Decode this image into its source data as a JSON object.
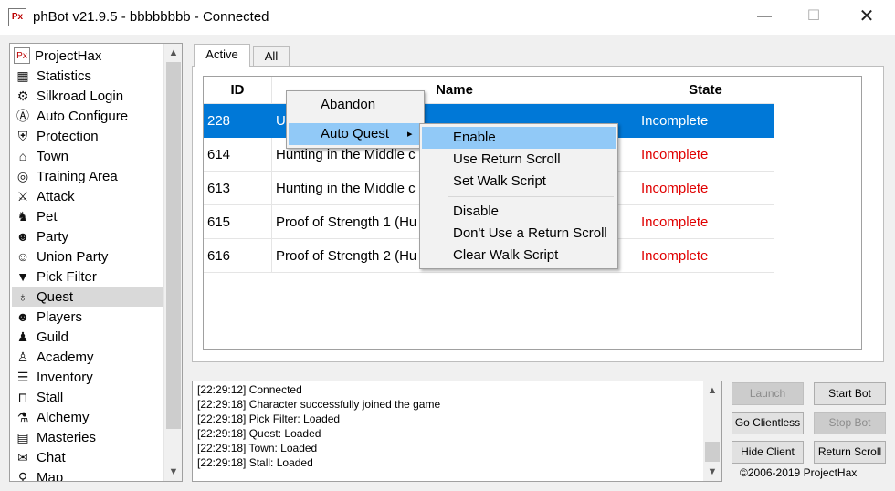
{
  "window": {
    "icon_text": "Px",
    "title": "phBot v21.9.5 - bbbbbbbb - Connected",
    "minimize": "—",
    "maximize": "☐",
    "close": "✕"
  },
  "sidebar": {
    "items": [
      {
        "label": "ProjectHax",
        "icon": "projecthax-icon",
        "glyph": "Px"
      },
      {
        "label": "Statistics",
        "icon": "statistics-icon",
        "glyph": "▦"
      },
      {
        "label": "Silkroad Login",
        "icon": "gears-icon",
        "glyph": "⚙"
      },
      {
        "label": "Auto Configure",
        "icon": "auto-configure-icon",
        "glyph": "Ⓐ"
      },
      {
        "label": "Protection",
        "icon": "shield-icon",
        "glyph": "⛨"
      },
      {
        "label": "Town",
        "icon": "town-icon",
        "glyph": "⌂"
      },
      {
        "label": "Training Area",
        "icon": "target-icon",
        "glyph": "◎"
      },
      {
        "label": "Attack",
        "icon": "sword-icon",
        "glyph": "⚔"
      },
      {
        "label": "Pet",
        "icon": "pet-icon",
        "glyph": "♞"
      },
      {
        "label": "Party",
        "icon": "party-icon",
        "glyph": "☻"
      },
      {
        "label": "Union Party",
        "icon": "union-party-icon",
        "glyph": "☺"
      },
      {
        "label": "Pick Filter",
        "icon": "filter-icon",
        "glyph": "▼"
      },
      {
        "label": "Quest",
        "icon": "quest-balloon-icon",
        "glyph": "♁",
        "selected": true
      },
      {
        "label": "Players",
        "icon": "players-icon",
        "glyph": "☻"
      },
      {
        "label": "Guild",
        "icon": "guild-icon",
        "glyph": "♟"
      },
      {
        "label": "Academy",
        "icon": "academy-icon",
        "glyph": "♙"
      },
      {
        "label": "Inventory",
        "icon": "inventory-icon",
        "glyph": "☰"
      },
      {
        "label": "Stall",
        "icon": "stall-icon",
        "glyph": "⊓"
      },
      {
        "label": "Alchemy",
        "icon": "alchemy-icon",
        "glyph": "⚗"
      },
      {
        "label": "Masteries",
        "icon": "masteries-icon",
        "glyph": "▤"
      },
      {
        "label": "Chat",
        "icon": "chat-icon",
        "glyph": "✉"
      },
      {
        "label": "Map",
        "icon": "map-icon",
        "glyph": "⚲"
      }
    ],
    "scroll_up": "▲",
    "scroll_down": "▼"
  },
  "tabs": [
    {
      "label": "Active"
    },
    {
      "label": "All"
    }
  ],
  "quest_table": {
    "headers": {
      "id": "ID",
      "name": "Name",
      "state": "State"
    },
    "rows": [
      {
        "id": "228",
        "name": "U",
        "state": "Incomplete"
      },
      {
        "id": "614",
        "name": "Hunting in the Middle c",
        "state": "Incomplete"
      },
      {
        "id": "613",
        "name": "Hunting in the Middle c",
        "state": "Incomplete"
      },
      {
        "id": "615",
        "name": "Proof of Strength 1 (Hu",
        "state": "Incomplete"
      },
      {
        "id": "616",
        "name": "Proof of Strength 2 (Hu",
        "state": "Incomplete"
      }
    ]
  },
  "context_menu": {
    "abandon": "Abandon",
    "auto_quest": "Auto Quest",
    "submenu_arrow": "▸",
    "submenu": {
      "enable": "Enable",
      "use_return_scroll": "Use Return Scroll",
      "set_walk_script": "Set Walk Script",
      "disable": "Disable",
      "dont_use_return_scroll": "Don't Use a Return Scroll",
      "clear_walk_script": "Clear Walk Script"
    }
  },
  "log": {
    "lines": [
      "[22:29:12] Connected",
      "[22:29:18] Character successfully joined the game",
      "[22:29:18] Pick Filter: Loaded",
      "[22:29:18] Quest: Loaded",
      "[22:29:18] Town: Loaded",
      "[22:29:18] Stall: Loaded"
    ],
    "scroll_up": "▲",
    "scroll_down": "▼"
  },
  "buttons": {
    "launch": "Launch",
    "start_bot": "Start Bot",
    "go_clientless": "Go Clientless",
    "stop_bot": "Stop Bot",
    "hide_client": "Hide Client",
    "return_scroll": "Return Scroll"
  },
  "footer": {
    "copyright": "©2006-2019 ProjectHax"
  },
  "colors": {
    "selection": "#0078d7",
    "incomplete": "#e00000",
    "menu_highlight": "#91c9f7"
  }
}
